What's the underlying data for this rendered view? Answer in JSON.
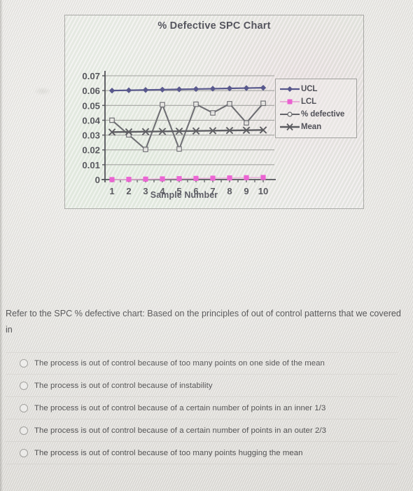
{
  "chart_data": {
    "type": "line",
    "title": "% Defective SPC Chart",
    "xlabel": "Sample Number",
    "ylabel": "",
    "categories": [
      "1",
      "2",
      "3",
      "4",
      "5",
      "6",
      "7",
      "8",
      "9",
      "10"
    ],
    "x": [
      1,
      2,
      3,
      4,
      5,
      6,
      7,
      8,
      9,
      10
    ],
    "ylim": [
      0,
      0.07
    ],
    "yticks": [
      "0.07",
      "0.06",
      "0.05",
      "0.04",
      "0.03",
      "0.02",
      "0.01",
      "0"
    ],
    "ytick_values": [
      0.07,
      0.06,
      0.05,
      0.04,
      0.03,
      0.02,
      0.01,
      0
    ],
    "grid": true,
    "legend_position": "right",
    "series": [
      {
        "name": "UCL",
        "values": [
          0.06,
          0.06,
          0.06,
          0.06,
          0.06,
          0.06,
          0.06,
          0.06,
          0.06,
          0.06
        ],
        "color": "#2a2a6e",
        "marker": "diamond"
      },
      {
        "name": "LCL",
        "values": [
          0,
          0,
          0,
          0,
          0,
          0,
          0,
          0,
          0,
          0
        ],
        "color": "#e838c8",
        "marker": "square"
      },
      {
        "name": "% defective",
        "values": [
          0.04,
          0.03,
          0.02,
          0.05,
          0.02,
          0.05,
          0.044,
          0.05,
          0.037,
          0.05
        ],
        "color": "#44444a",
        "marker": "open-triangle"
      },
      {
        "name": "Mean",
        "values": [
          0.032,
          0.032,
          0.032,
          0.032,
          0.032,
          0.032,
          0.032,
          0.032,
          0.032,
          0.032
        ],
        "color": "#2e2e34",
        "marker": "x"
      }
    ]
  },
  "question": {
    "text": "Refer to the SPC % defective chart: Based on the principles of out of control patterns that we covered in",
    "options": [
      {
        "label": "The process is out of control because of too many points on one side of the mean",
        "selected": false
      },
      {
        "label": "The process is out of control because of instability",
        "selected": false
      },
      {
        "label": "The process is out of control because of a certain number of points in an inner 1/3",
        "selected": false
      },
      {
        "label": "The process is out of control because of a certain number of points in an outer 2/3",
        "selected": false
      },
      {
        "label": "The process is out of control because of too many points hugging the mean",
        "selected": false
      }
    ]
  }
}
